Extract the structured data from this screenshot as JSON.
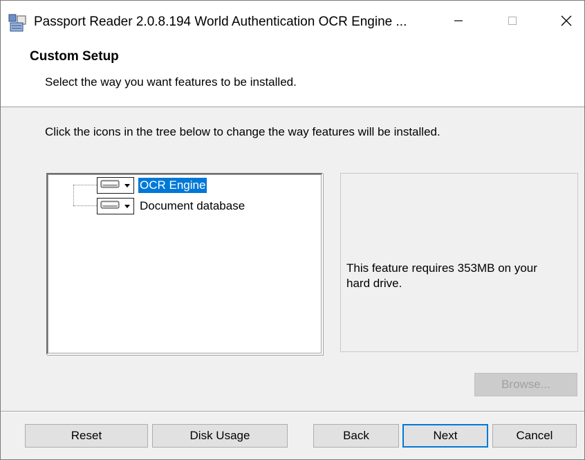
{
  "window": {
    "title": "Passport Reader 2.0.8.194 World Authentication OCR Engine ...",
    "icon": "installer-icon"
  },
  "titlebar_buttons": {
    "minimize_icon": "minimize-icon",
    "maximize_icon": "maximize-icon",
    "close_icon": "close-icon"
  },
  "header": {
    "title": "Custom Setup",
    "subtitle": "Select the way you want features to be installed."
  },
  "instruction": "Click the icons in the tree below to change the way features will be installed.",
  "tree": {
    "items": [
      {
        "label": "OCR Engine",
        "icon": "hard-drive-icon",
        "selected": true
      },
      {
        "label": "Document database",
        "icon": "hard-drive-icon",
        "selected": false
      }
    ]
  },
  "info": {
    "text": "This feature requires 353MB on your hard drive."
  },
  "buttons": {
    "browse": "Browse...",
    "reset": "Reset",
    "disk_usage": "Disk Usage",
    "back": "Back",
    "next": "Next",
    "cancel": "Cancel"
  },
  "colors": {
    "accent": "#0078d7",
    "window_bg": "#f0f0f0",
    "header_bg": "#ffffff"
  }
}
